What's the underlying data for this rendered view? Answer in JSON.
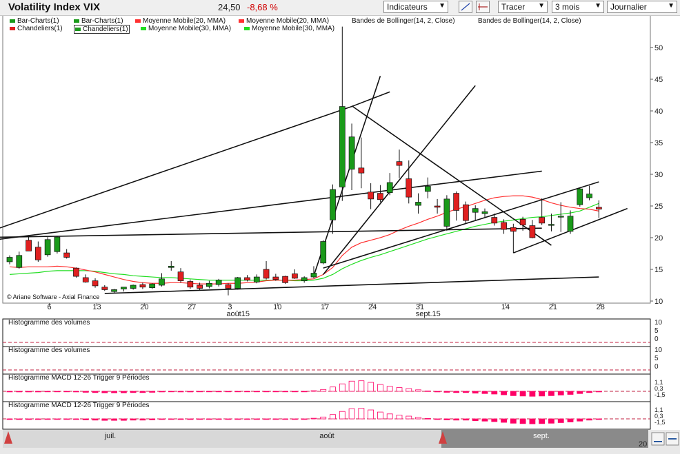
{
  "header": {
    "title": "Volatility Index VIX",
    "last_value": "24,50",
    "change": "-8,68 %",
    "indicators_label": "Indicateurs",
    "tracer_label": "Tracer",
    "period_label": "3 mois",
    "interval_label": "Journalier"
  },
  "legend": {
    "row1": [
      "Bar-Charts(1)",
      "Bar-Charts(1)",
      "Moyenne Mobile(20, MMA)",
      "Moyenne Mobile(20, MMA)",
      "Bandes de Bollinger(14, 2, Close)",
      "Bandes de Bollinger(14, 2, Close)"
    ],
    "row2": [
      "Chandeliers(1)",
      "Chandeliers(1)",
      "Moyenne Mobile(30, MMA)",
      "Moyenne Mobile(30, MMA)"
    ]
  },
  "copyright": "© Ariane Software - Axial Finance",
  "panels": {
    "volume1": "Histogramme des volumes",
    "volume2": "Histogramme des volumes",
    "macd1": "Histogramme MACD 12-26   Trigger 9 Périodes",
    "macd2": "Histogramme MACD 12-26   Trigger 9 Périodes"
  },
  "bottom": {
    "months": [
      "juil.",
      "août",
      "sept."
    ],
    "right_label": "20"
  },
  "colors": {
    "up": "#1a9a1a",
    "down": "#e02020",
    "ma20": "#ff3030",
    "ma30": "#22dd22",
    "macd": "#ff0066",
    "nav": "#8a8a8a"
  },
  "chart_data": {
    "type": "candlestick",
    "y_axis": {
      "ticks": [
        10,
        15,
        20,
        25,
        30,
        35,
        40,
        45,
        50
      ],
      "ylim": [
        10,
        53
      ]
    },
    "x_ticks": [
      {
        "i": 2,
        "label": "6"
      },
      {
        "i": 7,
        "label": "13"
      },
      {
        "i": 12,
        "label": "20"
      },
      {
        "i": 17,
        "label": "27"
      },
      {
        "i": 21,
        "label": "3"
      },
      {
        "i": 26,
        "label": "10"
      },
      {
        "i": 31,
        "label": "17"
      },
      {
        "i": 36,
        "label": "24"
      },
      {
        "i": 41,
        "label": "31"
      },
      {
        "i": 50,
        "label": "14"
      },
      {
        "i": 55,
        "label": "21"
      },
      {
        "i": 60,
        "label": "28"
      }
    ],
    "month_labels": [
      {
        "i": 22,
        "label": "août15"
      },
      {
        "i": 42,
        "label": "sept.15"
      }
    ],
    "candles": [
      {
        "o": 16.2,
        "h": 17.2,
        "l": 15.8,
        "c": 16.9
      },
      {
        "o": 15.3,
        "h": 17.8,
        "l": 15.1,
        "c": 17.2
      },
      {
        "o": 19.6,
        "h": 20.3,
        "l": 18.3,
        "c": 17.9
      },
      {
        "o": 18.5,
        "h": 19.4,
        "l": 16.2,
        "c": 16.5
      },
      {
        "o": 17.3,
        "h": 20.1,
        "l": 17.0,
        "c": 19.7
      },
      {
        "o": 17.8,
        "h": 20.3,
        "l": 17.5,
        "c": 20.1
      },
      {
        "o": 17.6,
        "h": 18.2,
        "l": 16.7,
        "c": 16.9
      },
      {
        "o": 15.2,
        "h": 15.3,
        "l": 13.7,
        "c": 13.9
      },
      {
        "o": 13.7,
        "h": 14.2,
        "l": 12.9,
        "c": 13.0
      },
      {
        "o": 13.2,
        "h": 13.6,
        "l": 12.1,
        "c": 12.4
      },
      {
        "o": 12.2,
        "h": 12.5,
        "l": 11.6,
        "c": 11.8
      },
      {
        "o": 11.5,
        "h": 11.9,
        "l": 11.2,
        "c": 11.8
      },
      {
        "o": 11.9,
        "h": 12.2,
        "l": 11.5,
        "c": 12.2
      },
      {
        "o": 12.0,
        "h": 12.6,
        "l": 11.8,
        "c": 12.5
      },
      {
        "o": 12.6,
        "h": 12.9,
        "l": 11.9,
        "c": 12.2
      },
      {
        "o": 12.1,
        "h": 12.8,
        "l": 11.9,
        "c": 12.7
      },
      {
        "o": 12.5,
        "h": 14.4,
        "l": 12.3,
        "c": 13.5
      },
      {
        "o": 15.3,
        "h": 16.3,
        "l": 14.8,
        "c": 15.5
      },
      {
        "o": 14.6,
        "h": 15.2,
        "l": 12.9,
        "c": 13.2
      },
      {
        "o": 13.1,
        "h": 13.4,
        "l": 11.9,
        "c": 12.2
      },
      {
        "o": 12.5,
        "h": 12.9,
        "l": 11.7,
        "c": 12.0
      },
      {
        "o": 12.3,
        "h": 13.2,
        "l": 12.0,
        "c": 12.8
      },
      {
        "o": 12.6,
        "h": 13.5,
        "l": 12.3,
        "c": 13.3
      },
      {
        "o": 12.6,
        "h": 12.8,
        "l": 10.9,
        "c": 12.0
      },
      {
        "o": 12.0,
        "h": 13.8,
        "l": 11.8,
        "c": 13.7
      },
      {
        "o": 13.7,
        "h": 14.1,
        "l": 13.1,
        "c": 13.3
      },
      {
        "o": 13.0,
        "h": 14.2,
        "l": 12.8,
        "c": 13.8
      },
      {
        "o": 15.0,
        "h": 16.3,
        "l": 13.4,
        "c": 13.6
      },
      {
        "o": 13.8,
        "h": 14.3,
        "l": 13.2,
        "c": 13.4
      },
      {
        "o": 13.9,
        "h": 14.0,
        "l": 12.7,
        "c": 12.9
      },
      {
        "o": 14.3,
        "h": 15.0,
        "l": 13.5,
        "c": 13.6
      },
      {
        "o": 13.2,
        "h": 13.9,
        "l": 12.9,
        "c": 13.7
      },
      {
        "o": 13.8,
        "h": 15.5,
        "l": 13.6,
        "c": 14.4
      },
      {
        "o": 16.0,
        "h": 19.6,
        "l": 15.8,
        "c": 19.4
      },
      {
        "o": 22.8,
        "h": 28.4,
        "l": 20.6,
        "c": 27.6
      },
      {
        "o": 28.0,
        "h": 53.3,
        "l": 25.8,
        "c": 40.7
      },
      {
        "o": 30.8,
        "h": 38.0,
        "l": 27.5,
        "c": 35.9
      },
      {
        "o": 31.0,
        "h": 35.8,
        "l": 27.8,
        "c": 30.2
      },
      {
        "o": 27.2,
        "h": 28.6,
        "l": 24.5,
        "c": 26.1
      },
      {
        "o": 27.0,
        "h": 28.3,
        "l": 25.6,
        "c": 26.0
      },
      {
        "o": 27.1,
        "h": 30.2,
        "l": 26.7,
        "c": 28.7
      },
      {
        "o": 32.0,
        "h": 33.9,
        "l": 29.4,
        "c": 31.4
      },
      {
        "o": 29.3,
        "h": 32.2,
        "l": 25.4,
        "c": 26.4
      },
      {
        "o": 25.1,
        "h": 27.0,
        "l": 23.8,
        "c": 25.6
      },
      {
        "o": 27.3,
        "h": 29.5,
        "l": 26.2,
        "c": 28.1
      },
      {
        "o": 25.0,
        "h": 26.1,
        "l": 23.8,
        "c": 24.8
      },
      {
        "o": 21.8,
        "h": 26.7,
        "l": 21.1,
        "c": 26.1
      },
      {
        "o": 27.0,
        "h": 27.3,
        "l": 22.7,
        "c": 24.3
      },
      {
        "o": 25.2,
        "h": 25.7,
        "l": 22.2,
        "c": 22.7
      },
      {
        "o": 24.0,
        "h": 25.1,
        "l": 22.7,
        "c": 24.6
      },
      {
        "o": 23.8,
        "h": 24.6,
        "l": 23.2,
        "c": 24.1
      },
      {
        "o": 23.2,
        "h": 23.8,
        "l": 21.9,
        "c": 22.3
      },
      {
        "o": 22.4,
        "h": 22.9,
        "l": 20.6,
        "c": 21.3
      },
      {
        "o": 21.6,
        "h": 22.2,
        "l": 17.6,
        "c": 21.0
      },
      {
        "o": 22.9,
        "h": 23.3,
        "l": 21.1,
        "c": 22.0
      },
      {
        "o": 21.9,
        "h": 22.8,
        "l": 19.9,
        "c": 20.0
      },
      {
        "o": 23.2,
        "h": 26.2,
        "l": 22.0,
        "c": 22.3
      },
      {
        "o": 22.0,
        "h": 23.8,
        "l": 21.0,
        "c": 22.1
      },
      {
        "o": 23.3,
        "h": 25.6,
        "l": 20.9,
        "c": 23.4
      },
      {
        "o": 21.0,
        "h": 24.3,
        "l": 20.6,
        "c": 23.4
      },
      {
        "o": 25.2,
        "h": 27.9,
        "l": 24.9,
        "c": 27.7
      },
      {
        "o": 26.3,
        "h": 28.2,
        "l": 25.9,
        "c": 26.9
      },
      {
        "o": 24.8,
        "h": 25.9,
        "l": 23.1,
        "c": 24.5
      }
    ],
    "ma20": [
      15.4,
      15.3,
      15.4,
      15.4,
      15.4,
      15.5,
      15.4,
      15.2,
      14.9,
      14.6,
      14.2,
      13.8,
      13.4,
      13.1,
      12.9,
      12.8,
      12.8,
      12.9,
      12.9,
      12.8,
      12.7,
      12.7,
      12.7,
      12.8,
      12.8,
      12.9,
      13.0,
      13.2,
      13.3,
      13.3,
      13.3,
      13.4,
      13.5,
      14.2,
      15.3,
      17.2,
      18.5,
      19.2,
      19.6,
      20.0,
      20.5,
      21.2,
      21.8,
      22.3,
      22.9,
      23.4,
      24.0,
      24.5,
      24.9,
      25.4,
      25.9,
      26.3,
      26.5,
      26.6,
      26.6,
      26.4,
      26.0,
      25.5,
      25.1,
      24.8,
      24.6,
      24.5,
      24.2
    ],
    "ma30": [
      14.2,
      14.3,
      14.4,
      14.5,
      14.7,
      14.8,
      14.8,
      14.8,
      14.8,
      14.7,
      14.5,
      14.3,
      14.2,
      14.0,
      13.9,
      13.8,
      13.7,
      13.7,
      13.6,
      13.5,
      13.4,
      13.3,
      13.3,
      13.3,
      13.3,
      13.3,
      13.3,
      13.3,
      13.3,
      13.3,
      13.2,
      13.2,
      13.3,
      13.6,
      14.2,
      15.1,
      15.8,
      16.4,
      16.9,
      17.3,
      17.8,
      18.3,
      18.8,
      19.3,
      19.8,
      20.2,
      20.6,
      21.0,
      21.4,
      21.8,
      22.1,
      22.4,
      22.6,
      22.8,
      23.0,
      23.2,
      23.3,
      23.5,
      23.7,
      23.9,
      24.2,
      24.8,
      25.4
    ],
    "trendlines": [
      {
        "i1": -4,
        "v1": 20.0,
        "i2": 36,
        "v2": 40.7
      },
      {
        "i1": 36,
        "v1": 40.7,
        "i2": 40,
        "v2": 43.0
      },
      {
        "i1": -4,
        "v1": 19.2,
        "i2": 56,
        "v2": 30.5
      },
      {
        "i1": -4,
        "v1": 20.0,
        "i2": 56,
        "v2": 21.5
      },
      {
        "i1": 10,
        "v1": 11.2,
        "i2": 62,
        "v2": 13.8
      },
      {
        "i1": 32,
        "v1": 14.0,
        "i2": 39,
        "v2": 45.5
      },
      {
        "i1": 33,
        "v1": 14.2,
        "i2": 49,
        "v2": 44.0
      },
      {
        "i1": 36,
        "v1": 40.8,
        "i2": 57,
        "v2": 18.8
      },
      {
        "i1": 33,
        "v1": 15.2,
        "i2": 62,
        "v2": 28.8
      },
      {
        "i1": 53,
        "v1": 17.6,
        "i2": 65,
        "v2": 24.6
      }
    ],
    "macd": [
      -0.05,
      -0.05,
      -0.05,
      -0.05,
      -0.03,
      -0.02,
      -0.02,
      -0.05,
      -0.08,
      -0.1,
      -0.12,
      -0.12,
      -0.12,
      -0.1,
      -0.1,
      -0.08,
      -0.05,
      -0.04,
      -0.05,
      -0.05,
      -0.04,
      -0.03,
      -0.02,
      -0.02,
      -0.02,
      -0.02,
      -0.02,
      -0.03,
      -0.02,
      -0.03,
      -0.03,
      -0.03,
      0.05,
      0.15,
      0.35,
      0.6,
      0.82,
      0.85,
      0.72,
      0.55,
      0.4,
      0.3,
      0.22,
      0.12,
      0.03,
      -0.05,
      -0.08,
      -0.1,
      -0.1,
      -0.15,
      -0.18,
      -0.22,
      -0.28,
      -0.35,
      -0.38,
      -0.4,
      -0.38,
      -0.35,
      -0.3,
      -0.25,
      -0.18,
      -0.1,
      -0.05
    ],
    "macd_axis_labels": [
      "1,1",
      "0,3",
      "-1,5"
    ],
    "volume_axis_labels": [
      "10",
      "5",
      "0"
    ]
  }
}
